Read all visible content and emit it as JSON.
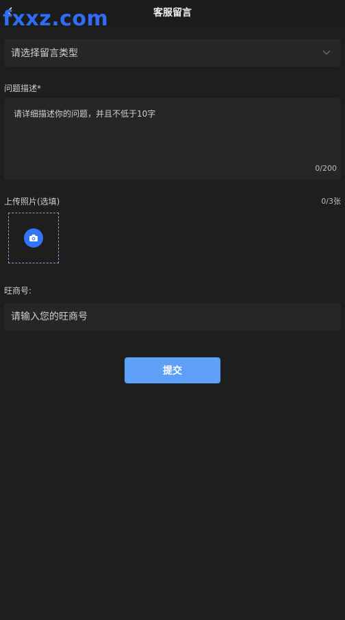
{
  "header": {
    "title": "客服留言",
    "watermark": "fxxz.com",
    "back_icon": "back-arrow-icon"
  },
  "form": {
    "type_select": {
      "placeholder": "请选择留言类型",
      "icon": "chevron-down-icon"
    },
    "description": {
      "label": "问题描述*",
      "placeholder": "请详细描述你的问题，并且不低于10字",
      "counter": "0/200"
    },
    "photos": {
      "label": "上传照片(选填)",
      "count": "0/3张",
      "upload_icon": "camera-icon"
    },
    "wangshang": {
      "label": "旺商号:",
      "placeholder": "请输入您的旺商号"
    },
    "submit_label": "提交"
  },
  "colors": {
    "background": "#1e1e1e",
    "accent": "#5ea0f7",
    "watermark": "#2f6df6"
  }
}
